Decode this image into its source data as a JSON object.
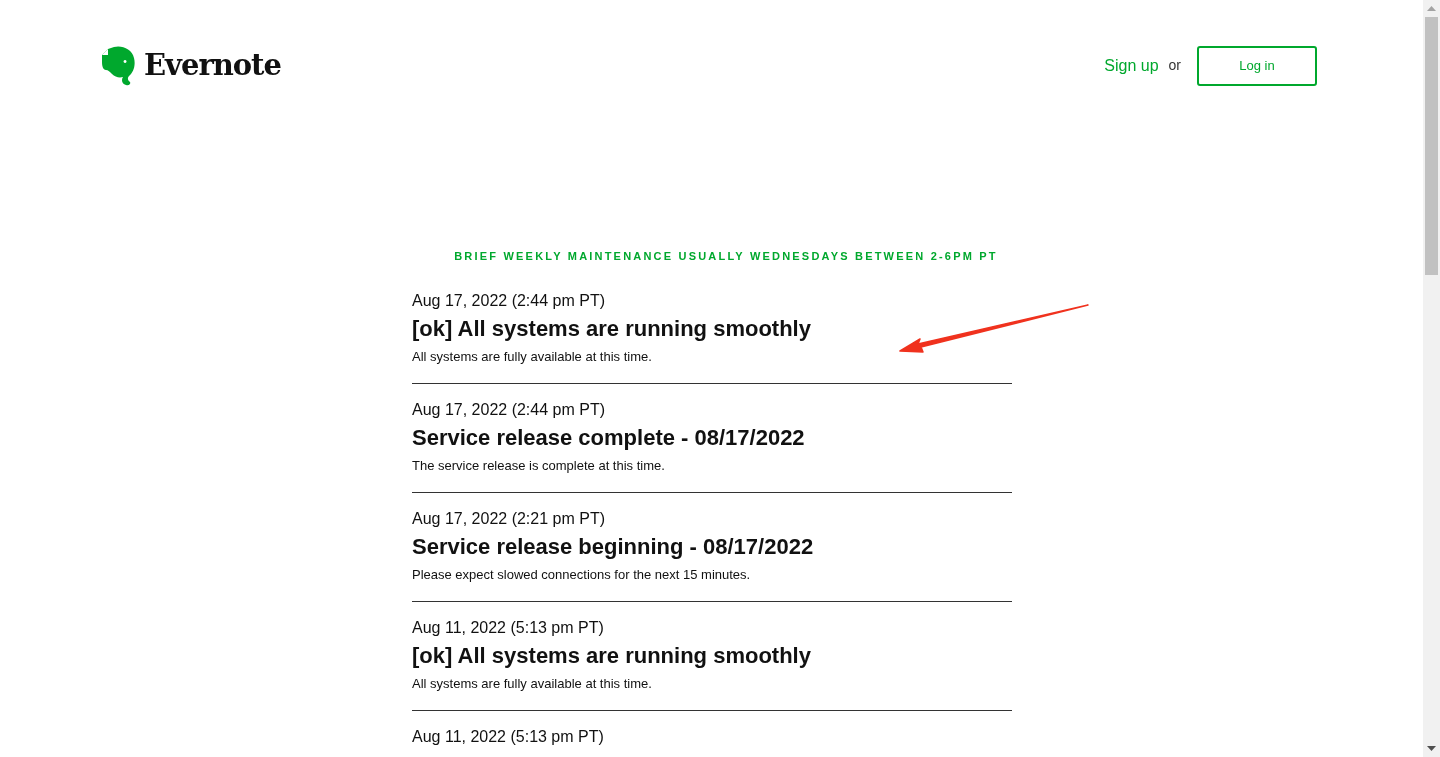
{
  "header": {
    "brand": "Evernote",
    "sign_up": "Sign up",
    "or": "or",
    "log_in": "Log in"
  },
  "banner": "BRIEF WEEKLY MAINTENANCE USUALLY WEDNESDAYS BETWEEN 2-6PM PT",
  "updates": [
    {
      "date": "Aug 17, 2022 (2:44 pm PT)",
      "title": "[ok] All systems are running smoothly",
      "description": "All systems are fully available at this time."
    },
    {
      "date": "Aug 17, 2022 (2:44 pm PT)",
      "title": "Service release complete - 08/17/2022",
      "description": "The service release is complete at this time."
    },
    {
      "date": "Aug 17, 2022 (2:21 pm PT)",
      "title": "Service release beginning - 08/17/2022",
      "description": "Please expect slowed connections for the next 15 minutes."
    },
    {
      "date": "Aug 11, 2022 (5:13 pm PT)",
      "title": "[ok] All systems are running smoothly",
      "description": "All systems are fully available at this time."
    },
    {
      "date": "Aug 11, 2022 (5:13 pm PT)"
    }
  ]
}
